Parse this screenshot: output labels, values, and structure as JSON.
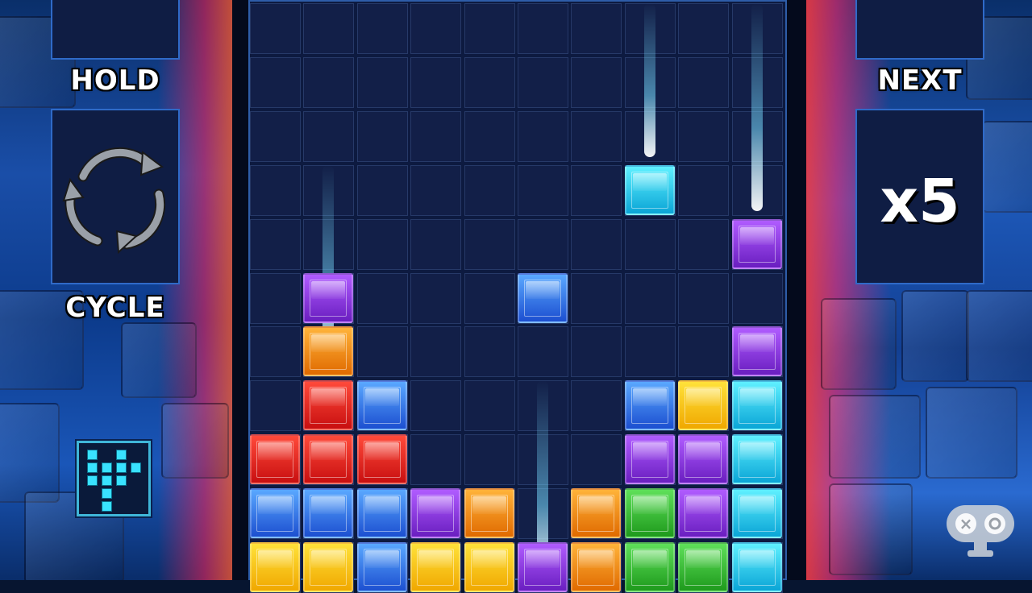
{
  "hold": {
    "label": "HOLD",
    "icon": "cycle-arrows-icon"
  },
  "cycle": {
    "label": "CYCLE"
  },
  "next": {
    "label": "NEXT",
    "value": "x5"
  },
  "board": {
    "columns": 10,
    "rows": 11,
    "blocks": [
      {
        "col": 7,
        "row": 3,
        "color": "cyan"
      },
      {
        "col": 9,
        "row": 4,
        "color": "purple"
      },
      {
        "col": 1,
        "row": 5,
        "color": "purple"
      },
      {
        "col": 5,
        "row": 5,
        "color": "blue"
      },
      {
        "col": 1,
        "row": 6,
        "color": "orange"
      },
      {
        "col": 9,
        "row": 6,
        "color": "purple"
      },
      {
        "col": 1,
        "row": 7,
        "color": "red"
      },
      {
        "col": 2,
        "row": 7,
        "color": "blue"
      },
      {
        "col": 7,
        "row": 7,
        "color": "blue"
      },
      {
        "col": 8,
        "row": 7,
        "color": "yellow"
      },
      {
        "col": 9,
        "row": 7,
        "color": "cyan"
      },
      {
        "col": 0,
        "row": 8,
        "color": "red"
      },
      {
        "col": 1,
        "row": 8,
        "color": "red"
      },
      {
        "col": 2,
        "row": 8,
        "color": "red"
      },
      {
        "col": 7,
        "row": 8,
        "color": "purple"
      },
      {
        "col": 8,
        "row": 8,
        "color": "purple"
      },
      {
        "col": 9,
        "row": 8,
        "color": "cyan"
      },
      {
        "col": 0,
        "row": 9,
        "color": "blue"
      },
      {
        "col": 1,
        "row": 9,
        "color": "blue"
      },
      {
        "col": 2,
        "row": 9,
        "color": "blue"
      },
      {
        "col": 3,
        "row": 9,
        "color": "purple"
      },
      {
        "col": 4,
        "row": 9,
        "color": "orange"
      },
      {
        "col": 6,
        "row": 9,
        "color": "orange"
      },
      {
        "col": 7,
        "row": 9,
        "color": "green"
      },
      {
        "col": 8,
        "row": 9,
        "color": "purple"
      },
      {
        "col": 9,
        "row": 9,
        "color": "cyan"
      },
      {
        "col": 0,
        "row": 10,
        "color": "yellow"
      },
      {
        "col": 1,
        "row": 10,
        "color": "yellow"
      },
      {
        "col": 2,
        "row": 10,
        "color": "blue"
      },
      {
        "col": 3,
        "row": 10,
        "color": "yellow"
      },
      {
        "col": 4,
        "row": 10,
        "color": "yellow"
      },
      {
        "col": 5,
        "row": 10,
        "color": "purple"
      },
      {
        "col": 6,
        "row": 10,
        "color": "orange"
      },
      {
        "col": 7,
        "row": 10,
        "color": "green"
      },
      {
        "col": 8,
        "row": 10,
        "color": "green"
      },
      {
        "col": 9,
        "row": 10,
        "color": "cyan"
      }
    ],
    "falling_trails": [
      {
        "col": 1,
        "from_row": 3,
        "to_row": 6
      },
      {
        "col": 5,
        "from_row": 7,
        "to_row": 10
      },
      {
        "col": 7,
        "from_row": 0,
        "to_row": 2
      },
      {
        "col": 9,
        "from_row": 0,
        "to_row": 3
      }
    ]
  },
  "minimap_icon": "minimap-tetromino-icon",
  "logo_icon": "controller-logo-icon",
  "colors": {
    "board_bg": "#121f48",
    "grid_line": "#263968",
    "panel_border": "#2f6ac8",
    "accent_wall_left": "#ff3a6a",
    "accent_wall_right": "#ff2f7a"
  }
}
